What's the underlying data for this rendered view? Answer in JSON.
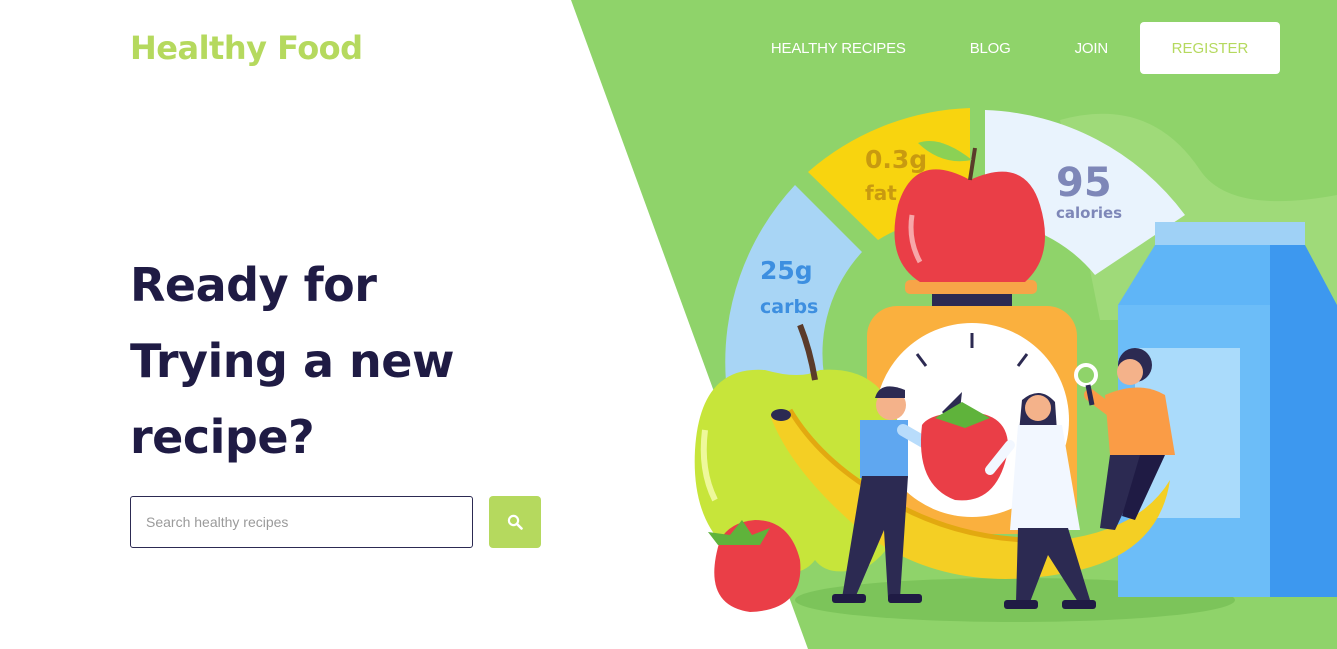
{
  "brand": {
    "name": "Healthy Food"
  },
  "nav": {
    "items": [
      {
        "label": "HEALTHY RECIPES"
      },
      {
        "label": "BLOG"
      },
      {
        "label": "JOIN"
      }
    ],
    "register_label": "REGISTER"
  },
  "hero": {
    "headline_lines": [
      "Ready for",
      "Trying a new",
      "recipe?"
    ],
    "search": {
      "placeholder": "Search healthy recipes",
      "value": ""
    }
  },
  "nutrition": {
    "fat": {
      "value": "0.3g",
      "label": "fat"
    },
    "calories": {
      "value": "95",
      "label": "calories"
    },
    "carbs": {
      "value": "25g",
      "label": "carbs"
    }
  },
  "colors": {
    "brand_green": "#b5d95e",
    "hero_green": "#8fd36a",
    "headline": "#1f1b44"
  },
  "icons": {
    "search": "search-icon"
  }
}
